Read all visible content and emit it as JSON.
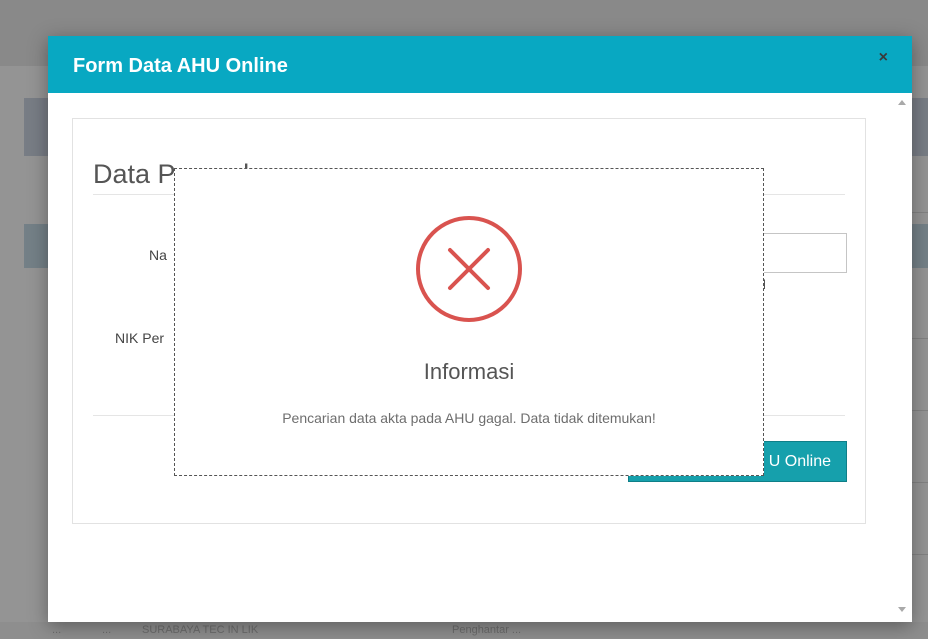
{
  "background": {
    "bottom_fragments": [
      "...",
      "...",
      "SURABAYA TEC IN LIK",
      "Penghantar ..."
    ]
  },
  "modal": {
    "title": "Form Data AHU Online",
    "close": "×"
  },
  "form": {
    "section_title": "Data Perusahaan",
    "label_nama_partial": "Na",
    "label_nik_partial": "NIK Per",
    "field_fragment": "l",
    "button_label_partial": "U Online"
  },
  "alert": {
    "icon": "error-x-icon",
    "title": "Informasi",
    "message": "Pencarian data akta pada AHU gagal. Data tidak ditemukan!",
    "color": "#d9534f"
  }
}
